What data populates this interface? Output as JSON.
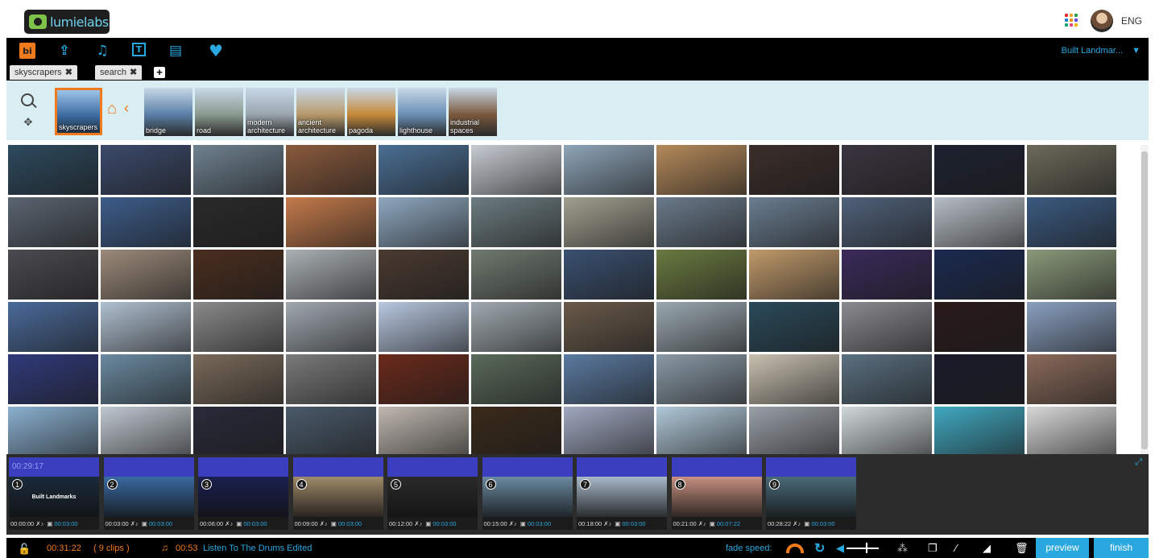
{
  "header": {
    "logo_text": "lumielabs",
    "language": "ENG",
    "apps_colors": [
      "#e03131",
      "#f5a623",
      "#2f9e44",
      "#1c7ed6",
      "#f08c00",
      "#7048e8",
      "#0ca678",
      "#e64980",
      "#fab005"
    ]
  },
  "toolbar": {
    "icons": [
      {
        "name": "storyboard-icon",
        "glyph": "bi",
        "active": true
      },
      {
        "name": "upload-icon",
        "glyph": "⇪"
      },
      {
        "name": "music-note-icon",
        "glyph": "♫"
      },
      {
        "name": "text-icon",
        "glyph": "T"
      },
      {
        "name": "document-icon",
        "glyph": "▤"
      },
      {
        "name": "heart-icon",
        "glyph": "♥"
      }
    ],
    "project_name": "Built Landmar..."
  },
  "tabs": [
    {
      "label": "skyscrapers",
      "close": "✖"
    },
    {
      "label": "search",
      "close": "✖"
    }
  ],
  "tab_add_label": "+",
  "categories": {
    "selected": {
      "label": "skyscrapers",
      "color": "#3a6a9e"
    },
    "items": [
      {
        "label": "bridge",
        "color": "#5b7fa8"
      },
      {
        "label": "road",
        "color": "#8a9a8e"
      },
      {
        "label": "modern architecture",
        "color": "#9aa5ae"
      },
      {
        "label": "ancient architecture",
        "color": "#b89a6b"
      },
      {
        "label": "pagoda",
        "color": "#c78a3a"
      },
      {
        "label": "lighthouse",
        "color": "#6a8fb4"
      },
      {
        "label": "industrial spaces",
        "color": "#7a5a3e"
      }
    ]
  },
  "grid": {
    "colors": [
      [
        "#2d4a5e",
        "#3b4a6b",
        "#6f8290",
        "#8a5a3c",
        "#4a6f94",
        "#c7ccd3",
        "#8ea5b8",
        "#b58a5a",
        "#3b2e2a",
        "#3a3540",
        "#1d2230",
        "#6b6a5a"
      ],
      [
        "#5a6470",
        "#3d5d8a",
        "#2a2a2a",
        "#c47a4a",
        "#8fa8c0",
        "#6c7c80",
        "#a0a090",
        "#6a7a8a",
        "#6a7d90",
        "#50617a",
        "#b7bec6",
        "#3a5a80"
      ],
      [
        "#4a4a50",
        "#9c8a7a",
        "#4a2e1e",
        "#aab0b4",
        "#4a3a30",
        "#707a70",
        "#3a5070",
        "#6a7a40",
        "#c09a6a",
        "#3a2a5a",
        "#1a2a50",
        "#8a9a7a"
      ],
      [
        "#4a6a9a",
        "#b0c0d0",
        "#8a8a8a",
        "#a0a8b0",
        "#b8c8e0",
        "#a0aab0",
        "#6a5a4a",
        "#9aa8b0",
        "#2a4a5a",
        "#8a8a90",
        "#2a1a1a",
        "#8aa0c0"
      ],
      [
        "#303a7a",
        "#6a8aa0",
        "#7a6a5a",
        "#7a7a7a",
        "#6a2a1a",
        "#5a6a5a",
        "#5a7aa0",
        "#8a9aa6",
        "#c8c0b0",
        "#5a7080",
        "#1a1a2a",
        "#8a6a5a"
      ],
      [
        "#8ab0d0",
        "#c0c8d0",
        "#2a2a3a",
        "#4a5a6a",
        "#c0b8b0",
        "#3a2a1a",
        "#a0a8c0",
        "#b0c8d8",
        "#9aa0a8",
        "#d0d8d8",
        "#40a8c0",
        "#d8d8d8"
      ]
    ]
  },
  "timeline": {
    "total_label": "00:29:17",
    "clips": [
      {
        "num": "1",
        "start": "00:00:00",
        "dur": "00:03:00",
        "color": "#1a2a3a",
        "caption": "Built Landmarks"
      },
      {
        "num": "2",
        "start": "00:03:00",
        "dur": "00:03:00",
        "color": "#3a6aa0",
        "caption": ""
      },
      {
        "num": "3",
        "start": "00:06:00",
        "dur": "00:03:00",
        "color": "#1a2050",
        "caption": ""
      },
      {
        "num": "4",
        "start": "00:09:00",
        "dur": "00:03:00",
        "color": "#a08a6a",
        "caption": ""
      },
      {
        "num": "5",
        "start": "00:12:00",
        "dur": "00:03:00",
        "color": "#2a2a2a",
        "caption": ""
      },
      {
        "num": "6",
        "start": "00:15:00",
        "dur": "00:03:00",
        "color": "#6a8aa0",
        "caption": ""
      },
      {
        "num": "7",
        "start": "00:18:00",
        "dur": "00:03:00",
        "color": "#a8b8c8",
        "caption": ""
      },
      {
        "num": "8",
        "start": "00:21:00",
        "dur": "00:07:22",
        "color": "#c89080",
        "caption": ""
      },
      {
        "num": "9",
        "start": "00:28:22",
        "dur": "00:03:00",
        "color": "#4a6a7a",
        "caption": ""
      }
    ],
    "mute_glyph": "✗♪",
    "film_glyph": "▣"
  },
  "bottom": {
    "total_time": "00:31:22",
    "clips_count": "( 9 clips )",
    "music_time": "00:53",
    "music_title": "Listen To The Drums Edited",
    "fade_label": "fade speed:",
    "preview_label": "preview",
    "finish_label": "finish"
  }
}
